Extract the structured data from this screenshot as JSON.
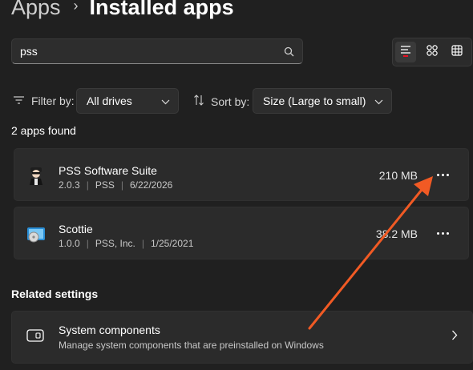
{
  "header": {
    "crumb": "Apps",
    "separator": "›",
    "current": "Installed apps"
  },
  "search": {
    "value": "pss",
    "placeholder": "",
    "icon": "search-icon"
  },
  "view_modes": [
    {
      "name": "list-view",
      "icon": "list-view-icon",
      "active": true
    },
    {
      "name": "grid-view",
      "icon": "grid-view-icon",
      "active": false
    },
    {
      "name": "tile-view",
      "icon": "tile-view-icon",
      "active": false
    }
  ],
  "filter": {
    "label": "Filter by:",
    "value": "All drives",
    "icon": "filter-icon"
  },
  "sort": {
    "label": "Sort by:",
    "value": "Size (Large to small)",
    "icon": "sort-icon"
  },
  "results_text": "2 apps found",
  "apps": [
    {
      "name": "PSS Software Suite",
      "version": "2.0.3",
      "publisher": "PSS",
      "date": "6/22/2026",
      "size": "210 MB",
      "icon": "pss-suite-icon"
    },
    {
      "name": "Scottie",
      "version": "1.0.0",
      "publisher": "PSS, Inc.",
      "date": "1/25/2021",
      "size": "38.2 MB",
      "icon": "scottie-icon"
    }
  ],
  "related": {
    "heading": "Related settings",
    "items": [
      {
        "title": "System components",
        "description": "Manage system components that are preinstalled on Windows",
        "icon": "system-components-icon"
      }
    ]
  },
  "colors": {
    "background": "#202020",
    "card": "#2b2b2b",
    "accent": "#e81123",
    "annotation_arrow": "#f15a24"
  }
}
